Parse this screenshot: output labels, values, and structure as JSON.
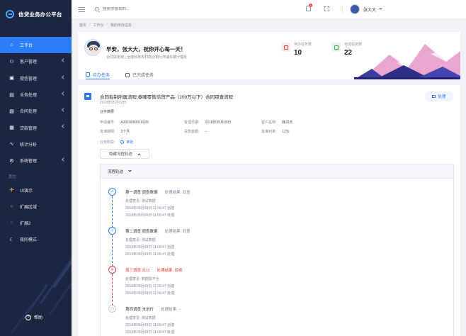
{
  "brand": {
    "title": "信贷业务办公平台"
  },
  "sidebar": {
    "items": [
      {
        "label": "工作台",
        "icon": "home-icon",
        "active": true
      },
      {
        "label": "客户管理",
        "icon": "customer-icon"
      },
      {
        "label": "授信管理",
        "icon": "credit-icon"
      },
      {
        "label": "业务处理",
        "icon": "business-icon"
      },
      {
        "label": "合同处理",
        "icon": "contract-icon"
      },
      {
        "label": "贷款管理",
        "icon": "loan-icon"
      },
      {
        "label": "统计分析",
        "icon": "stats-icon"
      },
      {
        "label": "系统管理",
        "icon": "system-icon"
      }
    ],
    "section": "其它",
    "others": [
      {
        "label": "UI演示",
        "icon": "ui-icon"
      },
      {
        "label": "扩展区域",
        "icon": "extend-icon"
      },
      {
        "label": "扩展2",
        "icon": "extend2-icon"
      },
      {
        "label": "夜间模式",
        "icon": "night-icon"
      }
    ],
    "help": "帮助"
  },
  "header": {
    "search_placeholder": "搜索你想找的...",
    "badge": "5",
    "username": "张大大"
  },
  "breadcrumb": [
    "首页",
    "工作台",
    "我的待办任务"
  ],
  "welcome": {
    "greeting": "早安，张大大，祝你开心每一天！",
    "subinfo": "合同拟定岗 | 全能科技农村商业银行环湖东路分理处",
    "stats": [
      {
        "label": "待办任务数",
        "value": "10",
        "color": "#f04134"
      },
      {
        "label": "完成任务数",
        "value": "22",
        "color": "#2fb344"
      }
    ],
    "tabs": [
      "待办任务",
      "已完成任务"
    ]
  },
  "task": {
    "title": "合同拟制所属流程:泰隆零售信贷产品（200万以下）合同审查流程",
    "date": "2018年05月09日",
    "handle_label": "处理",
    "section_label": "业务摘要",
    "fields": [
      {
        "label": "申请编号:",
        "value": "A2018050910925"
      },
      {
        "label": "受理日期:",
        "value": "2018年05月09日"
      },
      {
        "label": "客户名称:",
        "value": "韩洪杰"
      },
      {
        "label": "批准期限:",
        "value": "3个月"
      },
      {
        "label": "贷款金额:",
        "value": "--"
      },
      {
        "label": "批准利率:",
        "value": "12%"
      }
    ],
    "stage_label": "业务阶段:",
    "stage_value": "审批",
    "toggle_label": "隐藏流程轨迹",
    "flow_title": "流程轨迹",
    "steps": [
      {
        "status": "ok",
        "title": "第一调查  调查数据",
        "result": "处理结果: 同意",
        "opinion": "处理意见: 测试数据",
        "created": "2018年05月09日 11:06:47 创建",
        "handled": "2018年05月09日 11:06:47 处理"
      },
      {
        "status": "ok",
        "title": "第二调查  调查数据",
        "result": "处理结果: 同意",
        "opinion": "处理意见: 测试数据",
        "created": "2018年05月09日 11:06:47 创建",
        "handled": "2018年05月09日 11:06:47 处理"
      },
      {
        "status": "err",
        "title": "第三调查  1111",
        "result": "处理结果: 拒绝",
        "opinion": "处理意见: 数据损不全",
        "created": "2018年05月09日 11:06:47 创建",
        "handled": "2018年05月09日 11:06:47 处理"
      },
      {
        "status": "wait",
        "title": "第四调查  未进行",
        "result": "处理结果: --",
        "opinion": "处理意见: 测试数据",
        "created": "2018年05月09日 11:06:47 创建",
        "handled": "2018年05月09日 11:06:47 处理"
      }
    ]
  }
}
